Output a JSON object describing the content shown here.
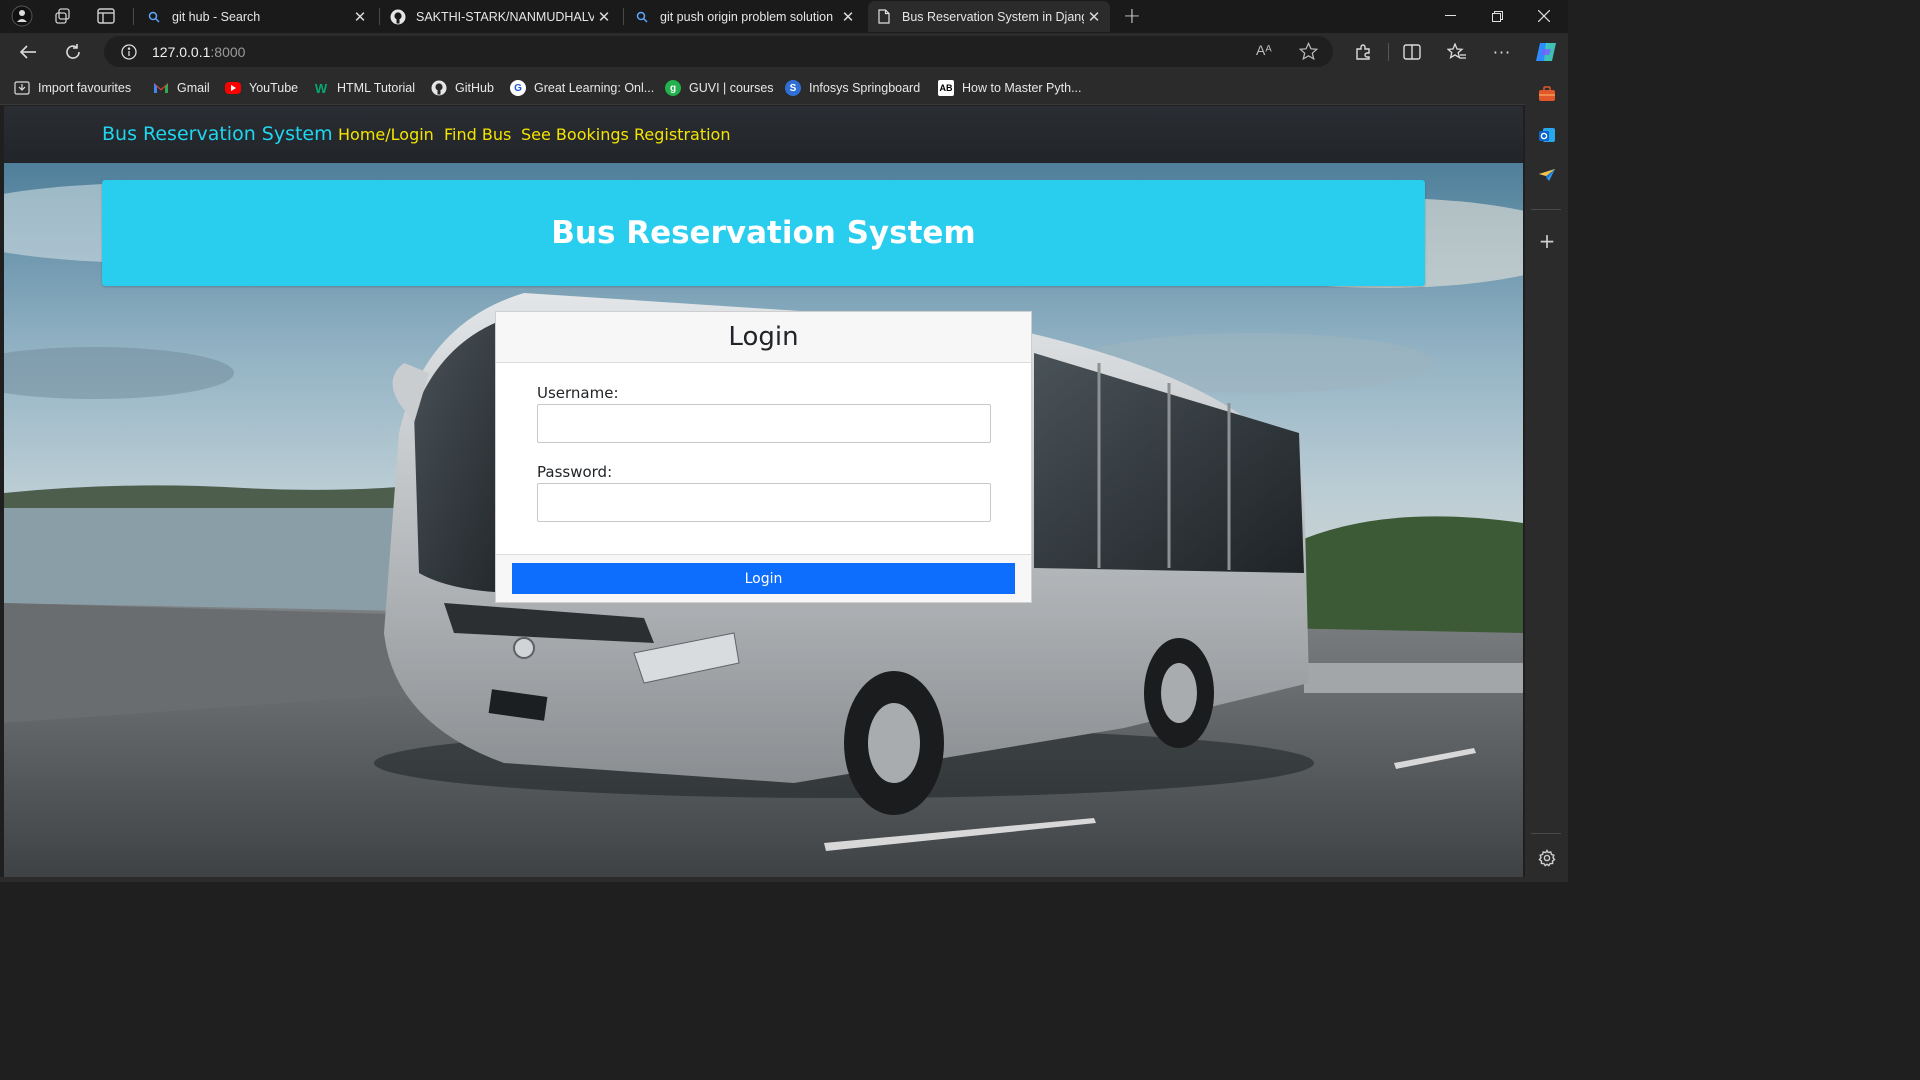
{
  "browser": {
    "tabs": [
      {
        "title": "git hub - Search",
        "icon": "search-icon",
        "active": false
      },
      {
        "title": "SAKTHI-STARK/NANMUDHALVAN",
        "icon": "github-icon",
        "active": false
      },
      {
        "title": "git push origin problem solution",
        "icon": "search-icon",
        "active": false
      },
      {
        "title": "Bus Reservation System in Django",
        "icon": "page-icon",
        "active": true
      }
    ],
    "address": {
      "host": "127.0.0.1",
      "port": ":8000"
    },
    "bookmarks": [
      {
        "label": "Import favourites",
        "icon": "import-icon"
      },
      {
        "label": "Gmail",
        "icon": "gmail-icon"
      },
      {
        "label": "YouTube",
        "icon": "youtube-icon"
      },
      {
        "label": "HTML Tutorial",
        "icon": "w3schools-icon"
      },
      {
        "label": "GitHub",
        "icon": "github-icon"
      },
      {
        "label": "Great Learning: Onl...",
        "icon": "great-learning-icon"
      },
      {
        "label": "GUVI | courses",
        "icon": "guvi-icon"
      },
      {
        "label": "Infosys Springboard",
        "icon": "infosys-icon"
      },
      {
        "label": "How to Master Pyth...",
        "icon": "ab-icon"
      }
    ],
    "read_aloud_glyph": "Aᴬ"
  },
  "navbar": {
    "brand": "Bus Reservation System",
    "links": [
      "Home/Login",
      "Find Bus",
      "See Bookings",
      "Registration"
    ]
  },
  "banner": {
    "title": "Bus Reservation System"
  },
  "login": {
    "title": "Login",
    "username_label": "Username:",
    "username_value": "",
    "password_label": "Password:",
    "password_value": "",
    "button_label": "Login"
  },
  "colors": {
    "brand": "#1fd6f0",
    "nav_link": "#f5e300",
    "banner": "#29cdee",
    "primary_button": "#0d6efd",
    "navbar_bg": "#212529"
  }
}
